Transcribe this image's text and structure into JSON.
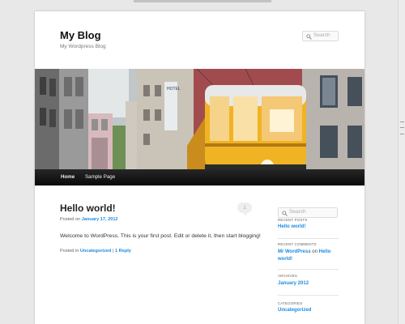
{
  "site": {
    "title": "My Blog",
    "description": "My Wordpress Blog"
  },
  "header_search": {
    "placeholder": "Search"
  },
  "nav": {
    "items": [
      {
        "label": "Home"
      },
      {
        "label": "Sample Page"
      }
    ]
  },
  "post": {
    "title": "Hello world!",
    "posted_on": "Posted on",
    "date": "January 17, 2012",
    "comment_count": "1",
    "body": "Welcome to WordPress. This is your first post. Edit or delete it, then start blogging!",
    "footer_prefix": "Posted in",
    "category": "Uncategorized",
    "separator": "|",
    "reply": "1 Reply"
  },
  "sidebar": {
    "search_placeholder": "Search",
    "recent_posts_title": "RECENT POSTS",
    "recent_post": "Hello world!",
    "recent_comments_title": "RECENT COMMENTS",
    "comment_author": "Mr WordPress",
    "comment_on": "on",
    "comment_post": "Hello world!",
    "archives_title": "ARCHIVES",
    "archive": "January 2012",
    "categories_title": "CATEGORIES",
    "category": "Uncategorized"
  },
  "colors": {
    "link": "#1b8be0",
    "nav_bg": "#111111",
    "tram": "#f0b323"
  },
  "icons": [
    "search-icon"
  ]
}
